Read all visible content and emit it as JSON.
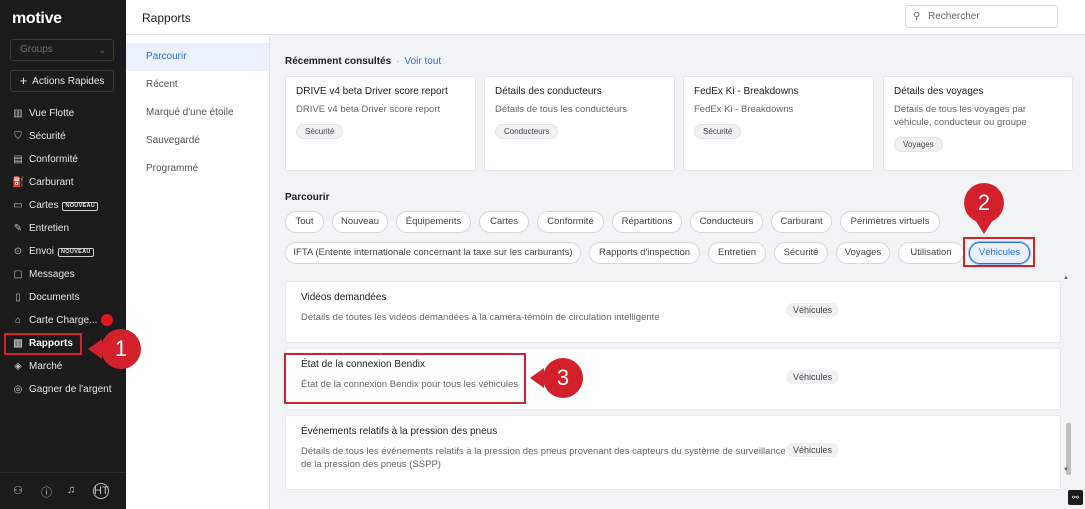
{
  "sidebar": {
    "logo": "motive",
    "groups_placeholder": "Groups",
    "quick_actions": "Actions Rapides",
    "items": [
      {
        "label": "Vue Flotte",
        "icon": "book-icon"
      },
      {
        "label": "Sécurité",
        "icon": "shield-icon"
      },
      {
        "label": "Conformité",
        "icon": "document-icon"
      },
      {
        "label": "Carburant",
        "icon": "fuel-icon"
      },
      {
        "label": "Cartes",
        "icon": "card-icon",
        "badge": "NOUVEAU"
      },
      {
        "label": "Entretien",
        "icon": "wrench-icon"
      },
      {
        "label": "Envoi",
        "icon": "dispatch-icon",
        "badge": "NOUVEAU"
      },
      {
        "label": "Messages",
        "icon": "message-icon"
      },
      {
        "label": "Documents",
        "icon": "file-icon"
      },
      {
        "label": "Carte Charge...",
        "icon": "charge-map-icon"
      },
      {
        "label": "Rapports",
        "icon": "reports-icon",
        "active": true
      },
      {
        "label": "Marché",
        "icon": "marketplace-icon"
      },
      {
        "label": "Gagner de l'argent",
        "icon": "money-icon"
      }
    ],
    "avatar_initials": "HT"
  },
  "header": {
    "title": "Rapports",
    "search_placeholder": "Rechercher"
  },
  "submenu": {
    "items": [
      "Parcourir",
      "Récent",
      "Marqué d'une étoile",
      "Sauvegardé",
      "Programmé"
    ],
    "active": "Parcourir"
  },
  "recent": {
    "title": "Récemment consultés",
    "view_all": "Voir tout",
    "cards": [
      {
        "title": "DRIVE v4 beta Driver score report",
        "desc": "DRIVE v4 beta Driver score report",
        "tag": "Sécurité"
      },
      {
        "title": "Détails des conducteurs",
        "desc": "Détails de tous les conducteurs",
        "tag": "Conducteurs"
      },
      {
        "title": "FedEx Ki - Breakdowns",
        "desc": "FedEx Ki - Breakdowns",
        "tag": "Sécurité"
      },
      {
        "title": "Détails des voyages",
        "desc": "Détails de tous les voyages par véhicule, conducteur ou groupe",
        "tag": "Voyages"
      }
    ]
  },
  "browse": {
    "title": "Parcourir",
    "chips_row1": [
      "Tout",
      "Nouveau",
      "Équipements",
      "Cartes",
      "Conformité",
      "Répartitions",
      "Conducteurs",
      "Carburant",
      "Périmètres virtuels"
    ],
    "chips_row2": [
      "IFTA (Entente internationale concernant la taxe sur les carburants)",
      "Rapports d'inspection",
      "Entretien",
      "Sécurité",
      "Voyages",
      "Utilisation",
      "Véhicules"
    ],
    "selected": "Véhicules"
  },
  "reports": [
    {
      "title": "Vidéos demandées",
      "desc": "Détails de toutes les vidéos demandées à la caméra-témoin de circulation intelligente",
      "tag": "Véhicules"
    },
    {
      "title": "État de la connexion Bendix",
      "desc": "État de la connexion Bendix pour tous les véhicules",
      "tag": "Véhicules"
    },
    {
      "title": "Événements relatifs à la pression des pneus",
      "desc": "Détails de tous les événements relatifs à la pression des pneus provenant des capteurs du système de surveillance de la pression des pneus (SSPP)",
      "tag": "Véhicules"
    }
  ],
  "annotations": [
    "1",
    "2",
    "3"
  ],
  "colors": {
    "accent": "#2c6ed5",
    "annotation": "#d3212c",
    "sidebar_bg": "#1b1b1c"
  }
}
